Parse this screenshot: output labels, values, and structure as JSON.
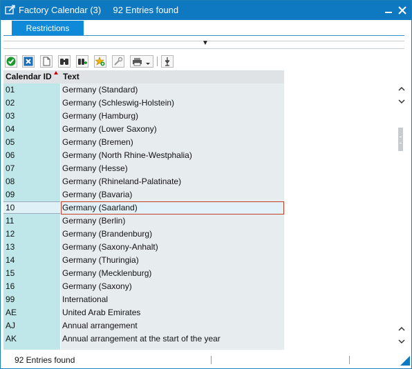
{
  "window": {
    "title": "Factory Calendar (3)",
    "count": "92 Entries found"
  },
  "tabs": [
    {
      "label": "Restrictions"
    }
  ],
  "toolbar": {
    "icons": [
      "ok-icon",
      "cancel-icon",
      "new-doc-icon",
      "find-icon",
      "find-next-icon",
      "add-favorite-icon",
      "personalize-icon",
      "print-icon",
      "sort-icon"
    ]
  },
  "table": {
    "headers": [
      "Calendar ID",
      "Text"
    ],
    "rows": [
      {
        "id": "01",
        "text": "Germany (Standard)"
      },
      {
        "id": "02",
        "text": "Germany (Schleswig-Holstein)"
      },
      {
        "id": "03",
        "text": "Germany (Hamburg)"
      },
      {
        "id": "04",
        "text": "Germany (Lower Saxony)"
      },
      {
        "id": "05",
        "text": "Germany (Bremen)"
      },
      {
        "id": "06",
        "text": "Germany (North Rhine-Westphalia)"
      },
      {
        "id": "07",
        "text": "Germany (Hesse)"
      },
      {
        "id": "08",
        "text": "Germany (Rhineland-Palatinate)"
      },
      {
        "id": "09",
        "text": "Germany (Bavaria)"
      },
      {
        "id": "10",
        "text": "Germany (Saarland)",
        "selected": true
      },
      {
        "id": "11",
        "text": "Germany (Berlin)"
      },
      {
        "id": "12",
        "text": "Germany (Brandenburg)"
      },
      {
        "id": "13",
        "text": "Germany (Saxony-Anhalt)"
      },
      {
        "id": "14",
        "text": "Germany (Thuringia)"
      },
      {
        "id": "15",
        "text": "Germany (Mecklenburg)"
      },
      {
        "id": "16",
        "text": "Germany (Saxony)"
      },
      {
        "id": "99",
        "text": "International"
      },
      {
        "id": "AE",
        "text": "United Arab Emirates"
      },
      {
        "id": "AJ",
        "text": "Annual arrangement"
      },
      {
        "id": "AK",
        "text": "Annual arrangement at the start of the year"
      }
    ]
  },
  "status": {
    "text": "92 Entries found"
  },
  "colors": {
    "titlebar": "#0e79c0",
    "tab": "#0e8ad8",
    "id_column": "#bfe7ea",
    "text_column": "#e7ecef",
    "selection_border": "#c23b22"
  }
}
